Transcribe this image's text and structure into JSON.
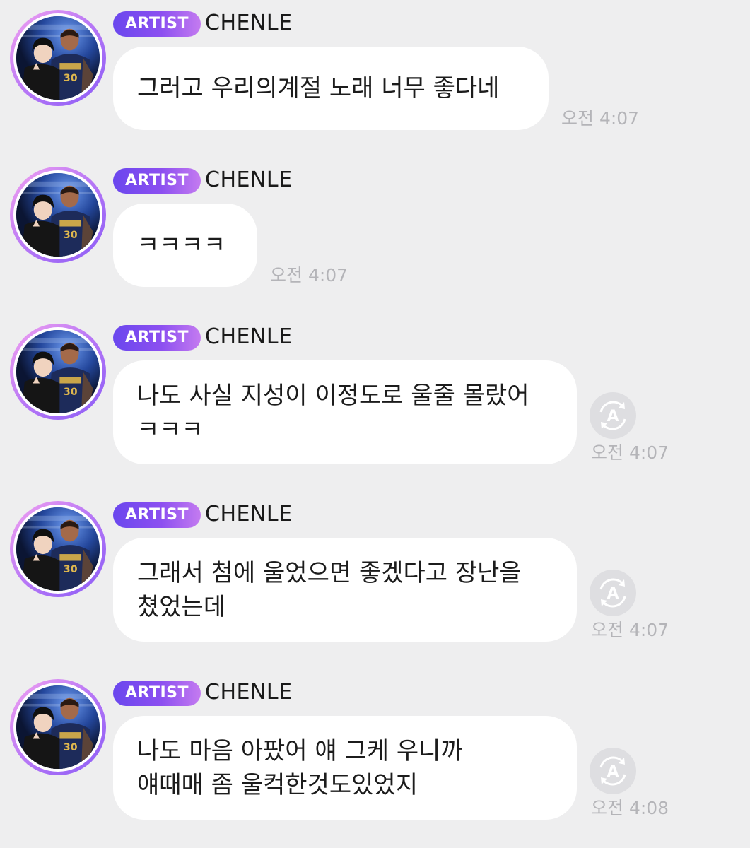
{
  "messages": [
    {
      "badge": "ARTIST",
      "name": "CHENLE",
      "lines": [
        "그러고 우리의계절 노래 너무 좋다네"
      ],
      "time": "오전 4:07",
      "translate_icon": false
    },
    {
      "badge": "ARTIST",
      "name": "CHENLE",
      "lines": [
        "ㅋㅋㅋㅋ"
      ],
      "time": "오전 4:07",
      "translate_icon": false
    },
    {
      "badge": "ARTIST",
      "name": "CHENLE",
      "lines": [
        "나도 사실 지성이 이정도로 울줄 몰랐어",
        "ㅋㅋㅋ"
      ],
      "time": "오전 4:07",
      "translate_icon": true
    },
    {
      "badge": "ARTIST",
      "name": "CHENLE",
      "lines": [
        "그래서 첨에 울었으면 좋겠다고 장난을",
        "쳤었는데"
      ],
      "time": "오전 4:07",
      "translate_icon": true
    },
    {
      "badge": "ARTIST",
      "name": "CHENLE",
      "lines": [
        "나도 마음 아팠어 얘 그케 우니까",
        "얘때매 좀 울컥한것도있었지"
      ],
      "time": "오전 4:08",
      "translate_icon": true
    }
  ],
  "icons": {
    "avatar": "profile-photo-icon",
    "translate": "translate-icon"
  },
  "colors": {
    "background": "#eeeeef",
    "badge_start": "#6a47ee",
    "badge_end": "#c47bf0",
    "bubble": "#ffffff",
    "time": "#b4b4b8"
  }
}
